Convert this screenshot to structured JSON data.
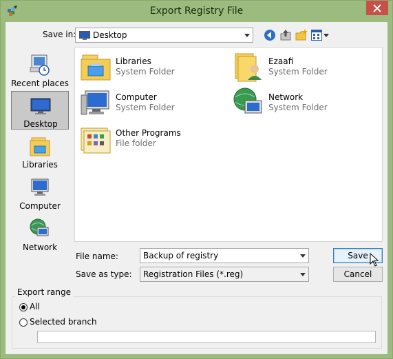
{
  "window": {
    "title": "Export Registry File"
  },
  "toolbar": {
    "save_in_label": "Save in:",
    "location": "Desktop"
  },
  "places": [
    {
      "label": "Recent places"
    },
    {
      "label": "Desktop"
    },
    {
      "label": "Libraries"
    },
    {
      "label": "Computer"
    },
    {
      "label": "Network"
    }
  ],
  "files": [
    {
      "name": "Libraries",
      "type": "System Folder"
    },
    {
      "name": "Ezaafi",
      "type": "System Folder"
    },
    {
      "name": "Computer",
      "type": "System Folder"
    },
    {
      "name": "Network",
      "type": "System Folder"
    },
    {
      "name": "Other Programs",
      "type": "File folder"
    }
  ],
  "form": {
    "file_name_label": "File name:",
    "file_name_value": "Backup of registry",
    "save_type_label": "Save as type:",
    "save_type_value": "Registration Files (*.reg)"
  },
  "buttons": {
    "save": "Save",
    "cancel": "Cancel"
  },
  "export_range": {
    "title": "Export range",
    "all": "All",
    "selected_branch": "Selected branch",
    "branch_value": ""
  },
  "colors": {
    "titlebar": "#9cbb7e",
    "close": "#c7504a",
    "accent": "#3c7fb1"
  }
}
